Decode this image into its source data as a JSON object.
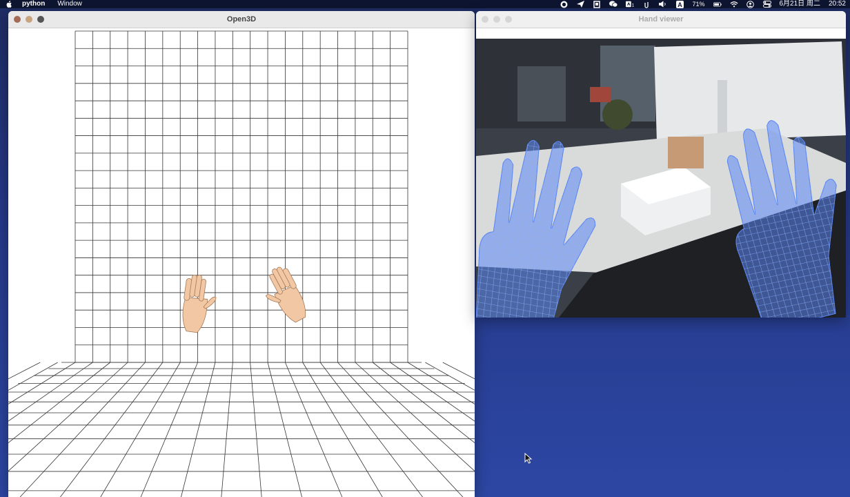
{
  "menubar": {
    "app_name": "python",
    "menus": [
      "Window"
    ],
    "battery": "71%",
    "date": "6月21日 周二",
    "time": "20:52"
  },
  "windows": {
    "open3d": {
      "title": "Open3D"
    },
    "hand_viewer": {
      "title": "Hand viewer"
    }
  },
  "colors": {
    "desktop_top": "#1e2c63",
    "desktop_bottom": "#2c47a3",
    "hand_mesh": "#5b86f2",
    "skin": "#f2c7a3"
  }
}
